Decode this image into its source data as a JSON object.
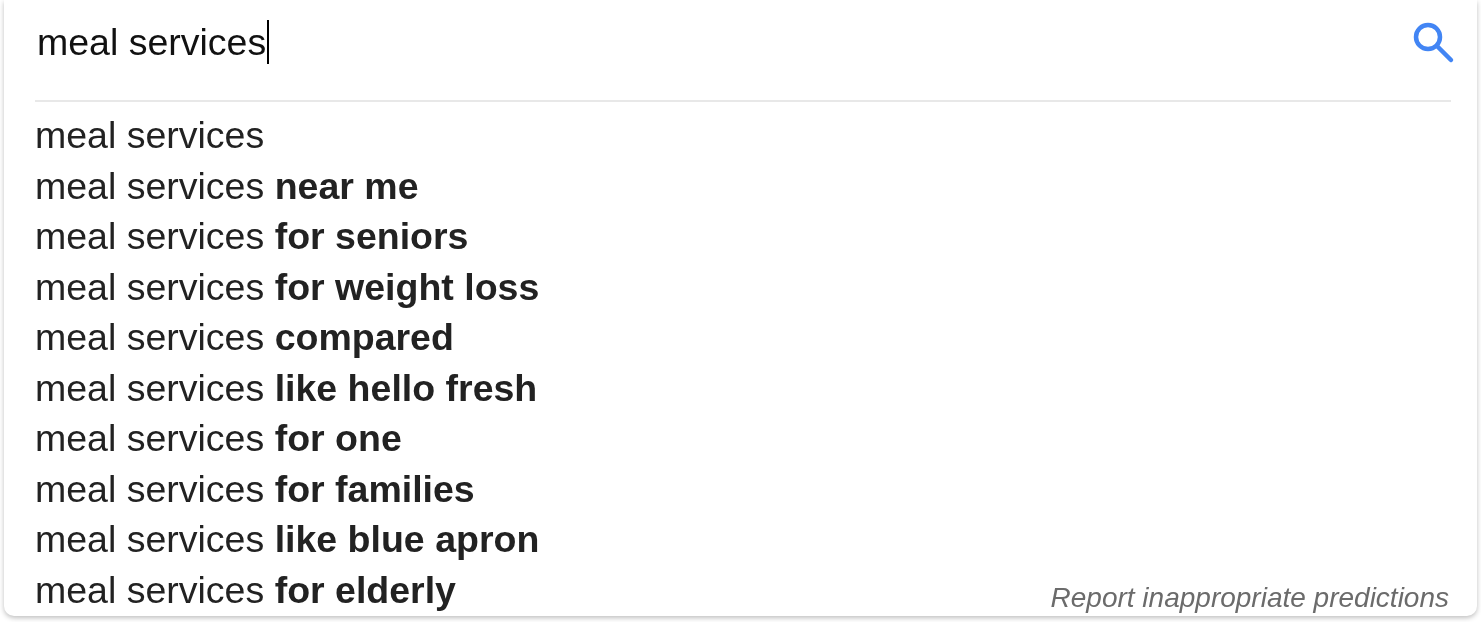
{
  "search": {
    "value": "meal services"
  },
  "suggestions": [
    "meal services",
    "meal services **near me**",
    "meal services **for seniors**",
    "meal services **for weight loss**",
    "meal services **compared**",
    "meal services **like hello fresh**",
    "meal services **for one**",
    "meal services **for families**",
    "meal services **like blue apron**",
    "meal services **for elderly**"
  ],
  "report_link": "Report inappropriate predictions"
}
